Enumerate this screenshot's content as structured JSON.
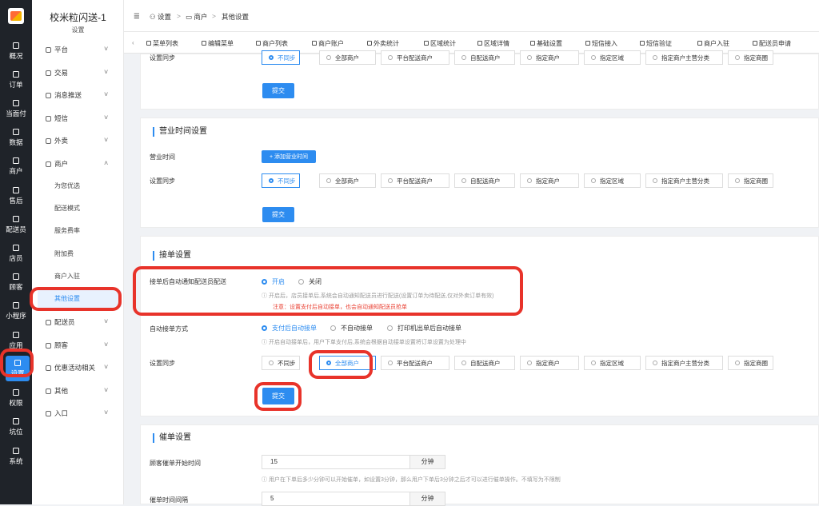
{
  "app": {
    "title": "校米粒闪送-1",
    "subtitle": "设置"
  },
  "leftnav": [
    {
      "label": "概况",
      "icon": "grid-icon"
    },
    {
      "label": "订单",
      "icon": "list-icon"
    },
    {
      "label": "当面付",
      "icon": "list-icon"
    },
    {
      "label": "数据",
      "icon": "bar-chart-icon"
    },
    {
      "label": "商户",
      "icon": "store-icon"
    },
    {
      "label": "售后",
      "icon": "headset-icon"
    },
    {
      "label": "配送员",
      "icon": "courier-icon"
    },
    {
      "label": "店员",
      "icon": "user-icon"
    },
    {
      "label": "顾客",
      "icon": "customer-icon"
    },
    {
      "label": "小程序",
      "icon": "miniprogram-icon"
    },
    {
      "label": "应用",
      "icon": "apps-icon"
    },
    {
      "label": "设置",
      "icon": "settings-icon"
    },
    {
      "label": "权限",
      "icon": "lock-icon"
    },
    {
      "label": "坑位",
      "icon": "slot-icon"
    },
    {
      "label": "系统",
      "icon": "windows-icon"
    }
  ],
  "sidebar": {
    "top": [
      "平台",
      "交易",
      "消息推送",
      "短信",
      "外卖",
      "商户"
    ],
    "sub": [
      "为您优选",
      "配送模式",
      "服务费率",
      "附加费",
      "商户入驻",
      "其他设置"
    ],
    "bottom": [
      "配送员",
      "顾客",
      "优惠活动相关",
      "其他",
      "入口"
    ]
  },
  "breadcrumb": [
    "设置",
    "商户",
    "其他设置"
  ],
  "tabs": [
    "菜单列表",
    "编辑菜单",
    "商户列表",
    "商户账户",
    "外卖统计",
    "区域统计",
    "区域详情",
    "基础设置",
    "短信接入",
    "短信验证",
    "商户入驻",
    "配送员申请"
  ],
  "sync_options": [
    "不同步",
    "全部商户",
    "平台配送商户",
    "自配送商户",
    "指定商户",
    "指定区域",
    "指定商户主营分类",
    "指定商圈"
  ],
  "submit": "提交",
  "section1": {
    "sync_label": "设置同步",
    "selected": 0
  },
  "business_hours": {
    "title": "营业时间设置",
    "hours_label": "营业时间",
    "add_button": "+ 添加营业时间",
    "sync_label": "设置同步",
    "selected": 0
  },
  "order_receive": {
    "title": "接单设置",
    "notify_label": "接单后自动通知配送员配送",
    "notify_options": [
      "开启",
      "关闭"
    ],
    "notify_hint": "开启后，店员接单后,系统会自动通知配送员进行配送(设置订单为待配送,仅对外卖订单有效)",
    "notify_warn": "注意：设置支付后自动接单，也会自动通知配送员抢单",
    "mode_label": "自动接单方式",
    "mode_options": [
      "支付后自动接单",
      "不自动接单",
      "打印机出单后自动接单"
    ],
    "mode_hint": "开启自动接单后，用户下单支付后,系统会根据自动接单设置将订单设置为处理中",
    "sync_label": "设置同步",
    "selected": 1
  },
  "reminder": {
    "title": "催单设置",
    "start_label": "顾客催单开始时间",
    "start_value": "15",
    "unit": "分钟",
    "start_hint": "用户在下单后多少分钟可以开始催单，如设置3分钟，那么用户下单后3分钟之后才可以进行催单操作。不填写为不限制",
    "interval_label": "催单时间间隔",
    "interval_value": "5"
  }
}
